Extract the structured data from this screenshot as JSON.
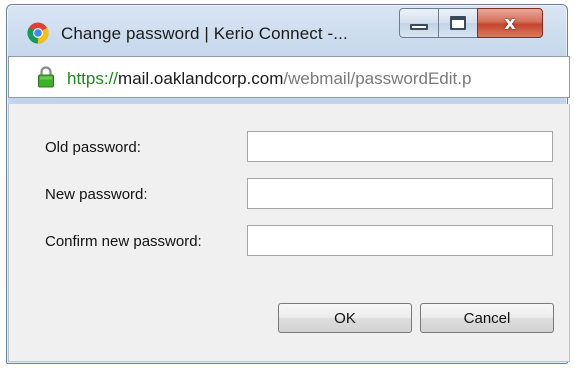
{
  "window": {
    "title": "Change password | Kerio Connect -...",
    "app_icon": "chrome-icon",
    "controls": {
      "minimize_icon": "minimize-icon",
      "maximize_icon": "maximize-icon",
      "close_glyph": "x"
    }
  },
  "address_bar": {
    "secure_icon": "lock-icon",
    "scheme": "https://",
    "host": "mail.oaklandcorp.com",
    "path": "/webmail/passwordEdit.p"
  },
  "form": {
    "old_password_label": "Old password:",
    "new_password_label": "New password:",
    "confirm_password_label": "Confirm new password:",
    "old_password_value": "",
    "new_password_value": "",
    "confirm_password_value": ""
  },
  "buttons": {
    "ok_label": "OK",
    "cancel_label": "Cancel"
  },
  "colors": {
    "secure_scheme": "#1a8a1a",
    "url_path": "#7a7a7a",
    "close_button": "#c4452c"
  }
}
